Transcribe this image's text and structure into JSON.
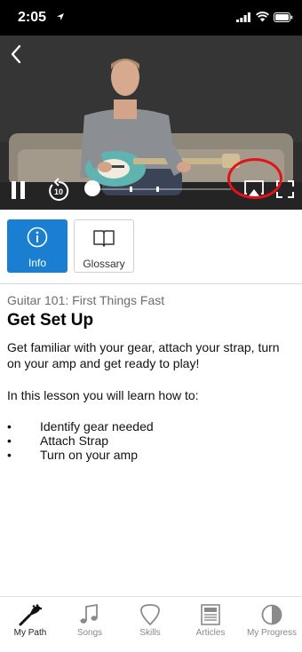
{
  "status_bar": {
    "time": "2:05"
  },
  "tabs": [
    {
      "label": "Info",
      "icon": "info-icon",
      "active": true
    },
    {
      "label": "Glossary",
      "icon": "book-icon",
      "active": false
    }
  ],
  "video": {
    "replay_seconds": "10",
    "progress": 0.02
  },
  "lesson": {
    "course": "Guitar 101: First Things Fast",
    "title": "Get Set Up",
    "description": "Get familiar with your gear, attach your strap, turn on your amp and get ready to play!",
    "intro": "In this lesson you will learn how to:",
    "objectives": [
      "Identify gear needed",
      "Attach Strap",
      "Turn on your amp"
    ]
  },
  "bottom_nav": [
    {
      "label": "My Path",
      "icon": "guitar-headstock-icon",
      "active": true
    },
    {
      "label": "Songs",
      "icon": "music-note-icon",
      "active": false
    },
    {
      "label": "Skills",
      "icon": "guitar-pick-icon",
      "active": false
    },
    {
      "label": "Articles",
      "icon": "article-icon",
      "active": false
    },
    {
      "label": "My Progress",
      "icon": "progress-circle-icon",
      "active": false
    }
  ],
  "colors": {
    "accent": "#1a7fd1",
    "highlight": "#e1121a"
  }
}
